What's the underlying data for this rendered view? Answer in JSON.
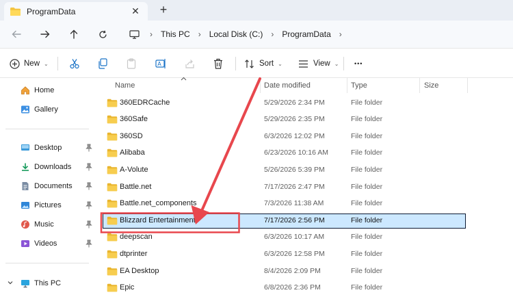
{
  "window": {
    "tab_title": "ProgramData",
    "close_glyph": "✕",
    "new_tab_glyph": "+"
  },
  "breadcrumb": {
    "items": [
      "This PC",
      "Local Disk (C:)",
      "ProgramData"
    ],
    "separator": "›"
  },
  "toolbar": {
    "new_label": "New",
    "sort_label": "Sort",
    "view_label": "View",
    "more_glyph": "•••",
    "dropdown_glyph": "⌄"
  },
  "sidebar": {
    "items": [
      {
        "label": "Home",
        "icon": "home-icon"
      },
      {
        "label": "Gallery",
        "icon": "gallery-icon"
      },
      {
        "label": "Desktop",
        "icon": "desktop-icon",
        "pinned": true
      },
      {
        "label": "Downloads",
        "icon": "downloads-icon",
        "pinned": true
      },
      {
        "label": "Documents",
        "icon": "documents-icon",
        "pinned": true
      },
      {
        "label": "Pictures",
        "icon": "pictures-icon",
        "pinned": true
      },
      {
        "label": "Music",
        "icon": "music-icon",
        "pinned": true
      },
      {
        "label": "Videos",
        "icon": "videos-icon",
        "pinned": true
      },
      {
        "label": "This PC",
        "icon": "computer-icon",
        "expanded": true
      }
    ]
  },
  "columns": {
    "name": "Name",
    "date": "Date modified",
    "type": "Type",
    "size": "Size"
  },
  "files": [
    {
      "name": "360EDRCache",
      "date": "5/29/2026 2:34 PM",
      "type": "File folder"
    },
    {
      "name": "360Safe",
      "date": "5/29/2026 2:35 PM",
      "type": "File folder"
    },
    {
      "name": "360SD",
      "date": "6/3/2026 12:02 PM",
      "type": "File folder"
    },
    {
      "name": "Alibaba",
      "date": "6/23/2026 10:16 AM",
      "type": "File folder"
    },
    {
      "name": "A-Volute",
      "date": "5/26/2026 5:39 PM",
      "type": "File folder"
    },
    {
      "name": "Battle.net",
      "date": "7/17/2026 2:47 PM",
      "type": "File folder"
    },
    {
      "name": "Battle.net_components",
      "date": "7/3/2026 11:38 AM",
      "type": "File folder"
    },
    {
      "name": "Blizzard Entertainment",
      "date": "7/17/2026 2:56 PM",
      "type": "File folder",
      "selected": true
    },
    {
      "name": "deepscan",
      "date": "6/3/2026 10:17 AM",
      "type": "File folder"
    },
    {
      "name": "dtprinter",
      "date": "6/3/2026 12:58 PM",
      "type": "File folder"
    },
    {
      "name": "EA Desktop",
      "date": "8/4/2026 2:09 PM",
      "type": "File folder"
    },
    {
      "name": "Epic",
      "date": "6/8/2026 2:36 PM",
      "type": "File folder"
    }
  ],
  "colors": {
    "folder": "#f4c542",
    "selection": "#cce8ff",
    "annotation": "#e8474d",
    "accent": "#1a73c7"
  }
}
